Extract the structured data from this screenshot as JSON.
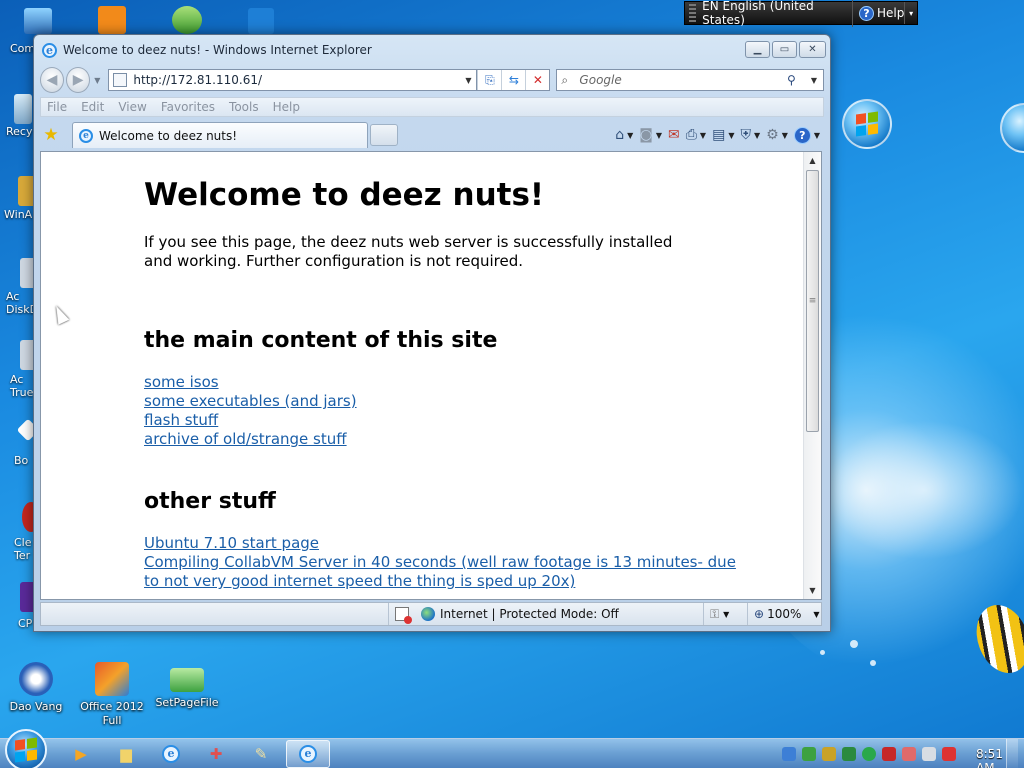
{
  "desktop": {
    "icons": [
      {
        "name": "computer",
        "label": "Com"
      },
      {
        "name": "recycle-bin",
        "label": "Recy"
      },
      {
        "name": "winamp",
        "label": "WinA"
      },
      {
        "name": "acronis-disk",
        "label": "Ac\nDiskD"
      },
      {
        "name": "acronis-true",
        "label": "Ac\nTrue"
      },
      {
        "name": "bo",
        "label": "Bo"
      },
      {
        "name": "cleaner",
        "label": "Cle\nTer"
      },
      {
        "name": "cpu",
        "label": "CP"
      }
    ],
    "bottom_icons": [
      {
        "name": "dao-vang",
        "label": "Dao Vang",
        "color": "#2a60b8"
      },
      {
        "name": "office-2012",
        "label": "Office 2012 Full",
        "color": "#d7462b"
      },
      {
        "name": "setpagefile",
        "label": "SetPageFile",
        "color": "#3da140"
      }
    ]
  },
  "langbar": {
    "language": "EN English (United States)",
    "help_label": "Help"
  },
  "ie": {
    "window_title": "Welcome to deez nuts! - Windows Internet Explorer",
    "address": "http://172.81.110.61/",
    "search_placeholder": "Google",
    "menu": [
      "File",
      "Edit",
      "View",
      "Favorites",
      "Tools",
      "Help"
    ],
    "tab_title": "Welcome to deez nuts!",
    "status": {
      "zone": "Internet | Protected Mode: Off",
      "zoom": "100%"
    }
  },
  "page": {
    "heading": "Welcome to deez nuts!",
    "intro": "If you see this page, the deez nuts web server is successfully installed and working. Further configuration is not required.",
    "section1": "the main content of this site",
    "links1": [
      "some isos",
      "some executables (and jars)",
      "flash stuff",
      "archive of old/strange stuff"
    ],
    "section2": "other stuff",
    "links2": [
      "Ubuntu 7.10 start page",
      "Compiling CollabVM Server in 40 seconds (well raw footage is 13 minutes- due to not very good internet speed the thing is sped up 20x)"
    ]
  },
  "taskbar": {
    "clock": "8:51 AM"
  },
  "colors": {
    "link": "#1a5ea8",
    "desktop_bg": "#1a8ae0"
  }
}
